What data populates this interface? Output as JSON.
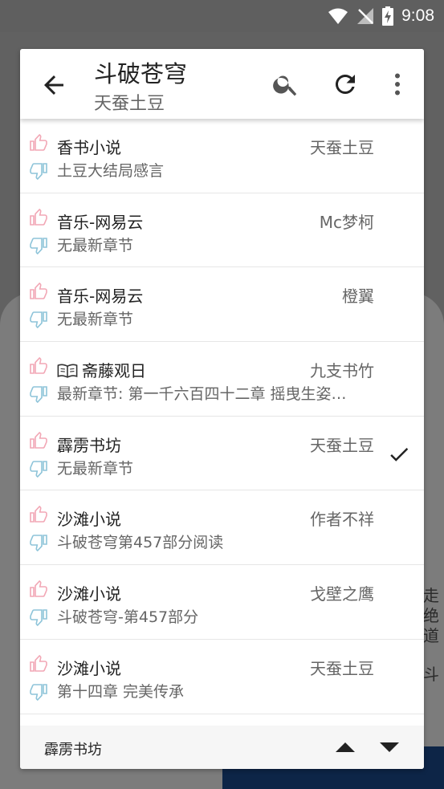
{
  "status_bar": {
    "time": "9:08"
  },
  "background": {
    "side_text": [
      "走",
      "绝",
      "道",
      "斗"
    ]
  },
  "dialog": {
    "title": "斗破苍穹",
    "subtitle": "天蚕土豆"
  },
  "sources": [
    {
      "name": "香书小说",
      "author": "天蚕土豆",
      "chapter": "土豆大结局感言",
      "book_icon": false,
      "selected": false
    },
    {
      "name": "音乐-网易云",
      "author": "Mc梦柯",
      "chapter": "无最新章节",
      "book_icon": false,
      "selected": false
    },
    {
      "name": "音乐-网易云",
      "author": "橙翼",
      "chapter": "无最新章节",
      "book_icon": false,
      "selected": false
    },
    {
      "name": "斋藤观日",
      "author": "九支书竹",
      "chapter": "最新章节: 第一千六百四十二章 摇曳生姿…",
      "book_icon": true,
      "selected": false
    },
    {
      "name": "霹雳书坊",
      "author": "天蚕土豆",
      "chapter": "无最新章节",
      "book_icon": false,
      "selected": true
    },
    {
      "name": "沙滩小说",
      "author": "作者不祥",
      "chapter": "斗破苍穹第457部分阅读",
      "book_icon": false,
      "selected": false
    },
    {
      "name": "沙滩小说",
      "author": "戈壁之鹰",
      "chapter": "斗破苍穹-第457部分",
      "book_icon": false,
      "selected": false
    },
    {
      "name": "沙滩小说",
      "author": "天蚕土豆",
      "chapter": "第十四章 完美传承",
      "book_icon": false,
      "selected": false
    }
  ],
  "bottom_bar": {
    "current_source": "霹雳书坊"
  },
  "colors": {
    "like": "#f2a7b5",
    "dislike": "#8ec4d9",
    "accent": "#222222"
  }
}
